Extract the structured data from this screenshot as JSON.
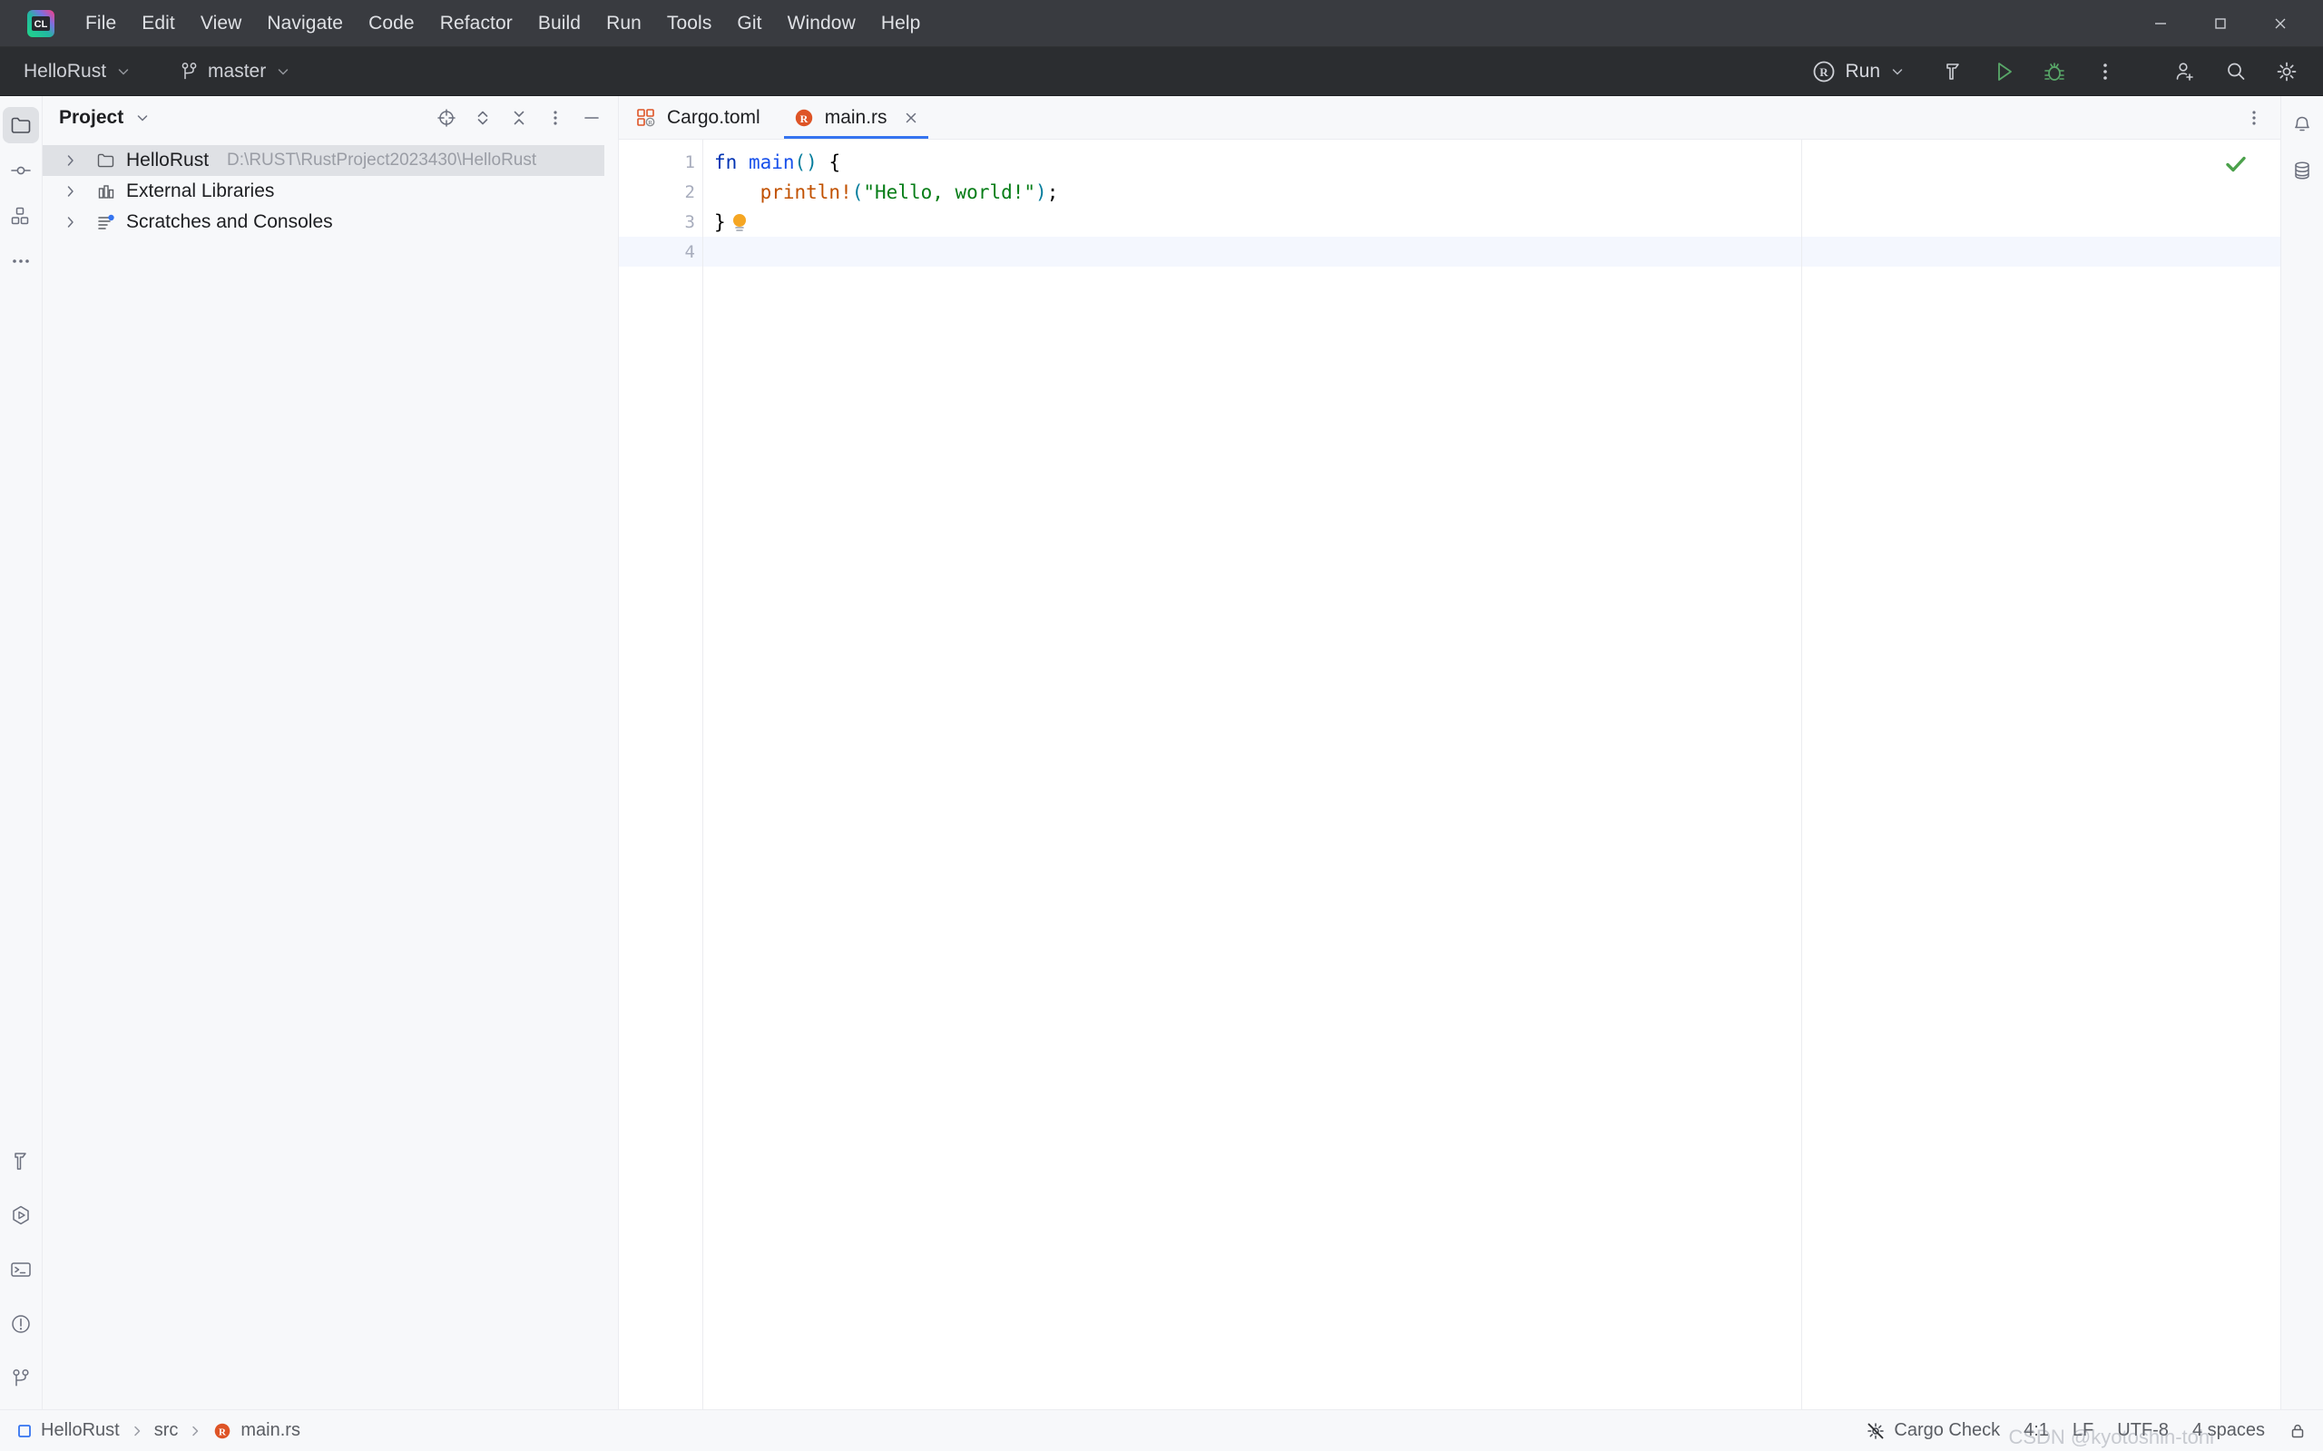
{
  "window": {
    "app_name": "CLion",
    "logo_text": "CL",
    "minimize_label": "—",
    "maximize_label": "▢",
    "close_label": "✕"
  },
  "menu": {
    "items": [
      {
        "label": "File",
        "mnemonic": "F"
      },
      {
        "label": "Edit",
        "mnemonic": "E"
      },
      {
        "label": "View",
        "mnemonic": "V"
      },
      {
        "label": "Navigate",
        "mnemonic": "N"
      },
      {
        "label": "Code",
        "mnemonic": "C"
      },
      {
        "label": "Refactor",
        "mnemonic": "R"
      },
      {
        "label": "Build",
        "mnemonic": "B"
      },
      {
        "label": "Run",
        "mnemonic": "u"
      },
      {
        "label": "Tools",
        "mnemonic": "T"
      },
      {
        "label": "Git",
        "mnemonic": "G"
      },
      {
        "label": "Window",
        "mnemonic": "W"
      },
      {
        "label": "Help",
        "mnemonic": "H"
      }
    ]
  },
  "navbar": {
    "project_name": "HelloRust",
    "branch_name": "master",
    "run_config_name": "Run",
    "icons": {
      "project_caret": "chevron-down-icon",
      "branch": "git-branch-icon",
      "branch_caret": "chevron-down-icon",
      "run_config_icon": "rust-logo-icon",
      "build": "hammer-icon",
      "run": "run-play-icon",
      "debug": "debug-bug-icon",
      "more": "more-vertical-icon",
      "account": "add-user-icon",
      "search": "search-icon",
      "settings": "gear-icon"
    }
  },
  "left_rail": {
    "top": [
      {
        "name": "project-tool-window",
        "icon": "folder-icon",
        "active": true
      },
      {
        "name": "commit-tool-window",
        "icon": "commit-icon",
        "active": false
      },
      {
        "name": "structure-tool-window",
        "icon": "structure-icon",
        "active": false
      },
      {
        "name": "more-tool-windows",
        "icon": "more-horizontal-icon",
        "active": false
      }
    ],
    "bottom": [
      {
        "name": "build-tool-window",
        "icon": "hammer-icon"
      },
      {
        "name": "run-tool-window",
        "icon": "run-hexagon-icon"
      },
      {
        "name": "terminal-tool-window",
        "icon": "terminal-icon"
      },
      {
        "name": "problems-tool-window",
        "icon": "warning-circle-icon"
      },
      {
        "name": "git-tool-window",
        "icon": "git-branch-icon"
      }
    ]
  },
  "right_rail": {
    "items": [
      {
        "name": "notifications",
        "icon": "bell-icon"
      },
      {
        "name": "database",
        "icon": "database-icon"
      }
    ]
  },
  "project_panel": {
    "title": "Project",
    "actions": [
      {
        "name": "select-opened-file",
        "icon": "locate-target-icon"
      },
      {
        "name": "expand-all",
        "icon": "expand-chevrons-icon"
      },
      {
        "name": "collapse-all",
        "icon": "collapse-chevrons-icon"
      },
      {
        "name": "options-menu",
        "icon": "more-vertical-icon"
      },
      {
        "name": "hide-tool-window",
        "icon": "minimize-dash-icon"
      }
    ],
    "tree": [
      {
        "label": "HelloRust",
        "path": "D:\\RUST\\RustProject2023430\\HelloRust",
        "icon": "folder-icon",
        "selected": true,
        "expanded": false
      },
      {
        "label": "External Libraries",
        "path": "",
        "icon": "library-icon",
        "selected": false,
        "expanded": false
      },
      {
        "label": "Scratches and Consoles",
        "path": "",
        "icon": "scratches-icon",
        "selected": false,
        "expanded": false
      }
    ]
  },
  "editor": {
    "tabs": [
      {
        "label": "Cargo.toml",
        "icon": "cargo-toml-icon",
        "active": false,
        "closable": false
      },
      {
        "label": "main.rs",
        "icon": "rust-file-icon",
        "active": true,
        "closable": true
      }
    ],
    "tab_options_icon": "more-vertical-icon",
    "inspection_status": "ok-check-icon",
    "lines": [
      {
        "number": "1",
        "gutter_icon": "run-gutter-play-icon",
        "current": false,
        "tokens": [
          {
            "text": "fn",
            "cls": "k-fn"
          },
          {
            "text": " ",
            "cls": "k-plain"
          },
          {
            "text": "main",
            "cls": "k-fname"
          },
          {
            "text": "()",
            "cls": "k-punct"
          },
          {
            "text": " ",
            "cls": "k-plain"
          },
          {
            "text": "{",
            "cls": "k-brace"
          }
        ]
      },
      {
        "number": "2",
        "gutter_icon": "",
        "current": false,
        "tokens": [
          {
            "text": "    ",
            "cls": "k-plain"
          },
          {
            "text": "println!",
            "cls": "k-macro"
          },
          {
            "text": "(",
            "cls": "k-punct"
          },
          {
            "text": "\"Hello, world!\"",
            "cls": "k-str"
          },
          {
            "text": ")",
            "cls": "k-punct"
          },
          {
            "text": ";",
            "cls": "k-brace"
          }
        ]
      },
      {
        "number": "3",
        "gutter_icon": "",
        "current": false,
        "bulb": "intention-bulb-icon",
        "tokens": [
          {
            "text": "}",
            "cls": "k-brace"
          }
        ]
      },
      {
        "number": "4",
        "gutter_icon": "",
        "current": true,
        "tokens": []
      }
    ]
  },
  "status_bar": {
    "breadcrumb": [
      {
        "label": "HelloRust",
        "icon": "module-square-icon"
      },
      {
        "label": "src",
        "icon": ""
      },
      {
        "label": "main.rs",
        "icon": "rust-file-icon"
      }
    ],
    "right_items": [
      {
        "label": "Cargo Check",
        "icon": "cargo-check-disabled-icon"
      },
      {
        "label": "4:1",
        "icon": ""
      },
      {
        "label": "LF",
        "icon": ""
      },
      {
        "label": "UTF-8",
        "icon": ""
      },
      {
        "label": "4 spaces",
        "icon": ""
      },
      {
        "label": "",
        "icon": "lock-icon"
      }
    ],
    "watermark": "CSDN @kyotoshin-tohi"
  },
  "colors": {
    "accent_blue": "#3574f0",
    "rust_orange": "#de5426",
    "run_green": "#59a869",
    "dark_bar": "#3c3f41",
    "nav_bar": "#2b2d30",
    "panel_bg": "#f7f8fa",
    "selection": "#dfe1e5",
    "current_line": "#f4f7fe"
  }
}
